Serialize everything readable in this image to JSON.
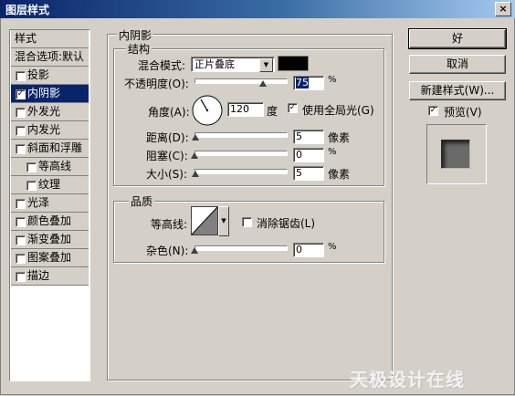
{
  "window": {
    "title": "图层样式",
    "close_glyph": "×"
  },
  "style_list": {
    "header": "样式",
    "blend_options": "混合选项:默认",
    "items": [
      {
        "label": "投影",
        "checked": false
      },
      {
        "label": "内阴影",
        "checked": true
      },
      {
        "label": "外发光",
        "checked": false
      },
      {
        "label": "内发光",
        "checked": false
      },
      {
        "label": "斜面和浮雕",
        "checked": false
      },
      {
        "label": "等高线",
        "checked": false
      },
      {
        "label": "纹理",
        "checked": false
      },
      {
        "label": "光泽",
        "checked": false
      },
      {
        "label": "颜色叠加",
        "checked": false
      },
      {
        "label": "渐变叠加",
        "checked": false
      },
      {
        "label": "图案叠加",
        "checked": false
      },
      {
        "label": "描边",
        "checked": false
      }
    ],
    "check_glyph": "✓"
  },
  "inner_shadow": {
    "section_title": "内阴影",
    "structure_title": "结构",
    "blend_mode_label": "混合模式:",
    "blend_mode_value": "正片叠底",
    "blend_color": "#000000",
    "opacity_label": "不透明度(O):",
    "opacity_value": "75",
    "opacity_unit": "%",
    "opacity_level": 0.75,
    "angle_label": "角度(A):",
    "angle_value": "120",
    "angle_unit": "度",
    "global_light_label": "使用全局光(G)",
    "global_light_checked": true,
    "distance_label": "距离(D):",
    "distance_value": "5",
    "distance_unit": "像素",
    "choke_label": "阻塞(C):",
    "choke_value": "0",
    "choke_unit": "%",
    "size_label": "大小(S):",
    "size_value": "5",
    "size_unit": "像素",
    "quality_title": "品质",
    "contour_label": "等高线:",
    "anti_alias_label": "消除锯齿(L)",
    "anti_alias_checked": false,
    "noise_label": "杂色(N):",
    "noise_value": "0",
    "noise_unit": "%"
  },
  "buttons": {
    "ok": "好",
    "cancel": "取消",
    "new_style": "新建样式(W)...",
    "preview_label": "预览(V)",
    "preview_checked": true
  },
  "watermark": "天极设计在线",
  "colors": {
    "title_gradient_start": "#0a246a",
    "selection": "#0a246a",
    "dialog_bg": "#d4d0c8"
  },
  "icons": [
    "close-icon",
    "checkbox-icon",
    "dropdown-arrow-icon",
    "angle-dial-icon",
    "contour-curve-icon",
    "slider-thumb-icon"
  ]
}
